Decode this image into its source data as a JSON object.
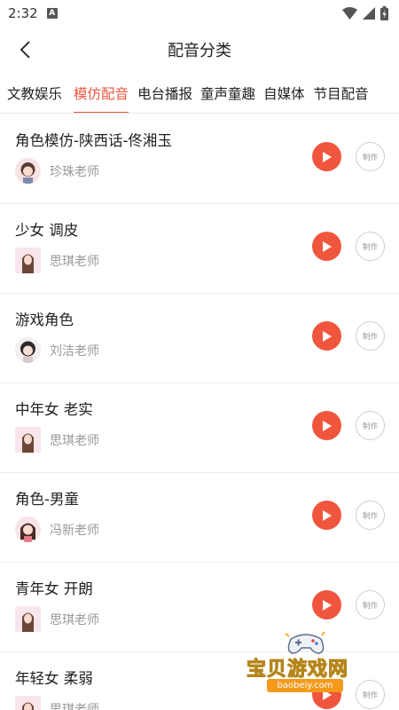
{
  "status_bar": {
    "time": "2:32",
    "notification_badge": "A"
  },
  "header": {
    "title": "配音分类"
  },
  "tabs": [
    {
      "label": "文教娱乐",
      "active": false
    },
    {
      "label": "模仿配音",
      "active": true
    },
    {
      "label": "电台播报",
      "active": false
    },
    {
      "label": "童声童趣",
      "active": false
    },
    {
      "label": "自媒体",
      "active": false
    },
    {
      "label": "节目配音",
      "active": false
    }
  ],
  "make_label": "制作",
  "items": [
    {
      "title": "角色模仿-陕西话-佟湘玉",
      "teacher": "珍珠老师"
    },
    {
      "title": "少女 调皮",
      "teacher": "思琪老师"
    },
    {
      "title": "游戏角色",
      "teacher": "刘洁老师"
    },
    {
      "title": "中年女 老实",
      "teacher": "思琪老师"
    },
    {
      "title": "角色-男童",
      "teacher": "冯新老师"
    },
    {
      "title": "青年女 开朗",
      "teacher": "思琪老师"
    },
    {
      "title": "年轻女 柔弱",
      "teacher": "思琪老师"
    }
  ],
  "watermark": {
    "text": "宝贝游戏网",
    "url": "baobeiy.com"
  },
  "colors": {
    "accent": "#f0553d"
  }
}
